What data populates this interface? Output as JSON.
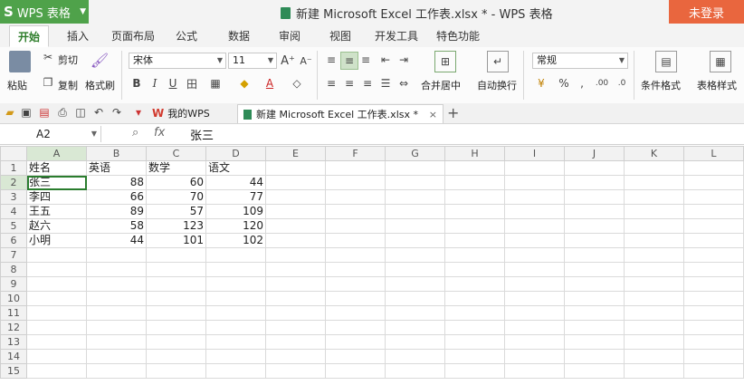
{
  "app": {
    "name": "WPS 表格",
    "logo": "S"
  },
  "window": {
    "title": "新建 Microsoft Excel 工作表.xlsx * - WPS 表格",
    "login_label": "未登录"
  },
  "tabs": [
    "开始",
    "插入",
    "页面布局",
    "公式",
    "数据",
    "审阅",
    "视图",
    "开发工具",
    "特色功能"
  ],
  "ribbon": {
    "paste": "粘贴",
    "cut": "剪切",
    "copy": "复制",
    "format_painter": "格式刷",
    "font_name": "宋体",
    "font_size": "11",
    "merge_center": "合并居中",
    "wrap_text": "自动换行",
    "number_format": "常规",
    "conditional_format": "条件格式",
    "table_style": "表格样式"
  },
  "doc_tabs": {
    "home": "我的WPS",
    "current": "新建 Microsoft Excel 工作表.xlsx *"
  },
  "formula_bar": {
    "name_box": "A2",
    "fx": "fx",
    "content": "张三"
  },
  "sheet": {
    "columns": [
      "A",
      "B",
      "C",
      "D",
      "E",
      "F",
      "G",
      "H",
      "I",
      "J",
      "K",
      "L"
    ],
    "rows": [
      [
        "姓名",
        "英语",
        "数学",
        "语文"
      ],
      [
        "张三",
        "88",
        "60",
        "44"
      ],
      [
        "李四",
        "66",
        "70",
        "77"
      ],
      [
        "王五",
        "89",
        "57",
        "109"
      ],
      [
        "赵六",
        "58",
        "123",
        "120"
      ],
      [
        "小明",
        "44",
        "101",
        "102"
      ]
    ],
    "row_numbers": [
      "1",
      "2",
      "3",
      "4",
      "5",
      "6",
      "7",
      "8",
      "9",
      "10",
      "11",
      "12",
      "13",
      "14",
      "15"
    ]
  }
}
